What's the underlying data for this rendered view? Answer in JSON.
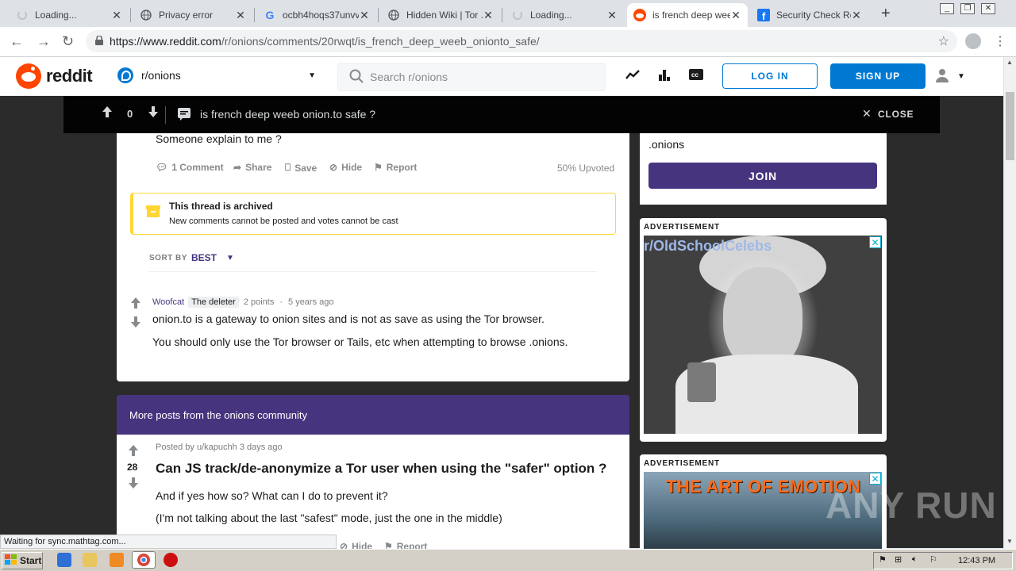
{
  "browser": {
    "tabs": [
      {
        "title": "Loading...",
        "favicon": "spinner"
      },
      {
        "title": "Privacy error",
        "favicon": "globe-icon"
      },
      {
        "title": "ocbh4hoqs37unvv",
        "favicon": "google-icon"
      },
      {
        "title": "Hidden Wiki | Tor .",
        "favicon": "globe-icon"
      },
      {
        "title": "Loading...",
        "favicon": "spinner"
      },
      {
        "title": "is french deep wee",
        "favicon": "reddit-icon",
        "active": true
      },
      {
        "title": "Security Check Rec",
        "favicon": "facebook-icon"
      }
    ],
    "new_tab": "+",
    "url_host": "https://www.reddit.com",
    "url_path": "/r/onions/comments/20rwqt/is_french_deep_weeb_onionto_safe/",
    "status_text": "Waiting for sync.mathtag.com..."
  },
  "header": {
    "logo_text": "reddit",
    "community": "r/onions",
    "search_placeholder": "Search r/onions",
    "login": "LOG IN",
    "signup": "SIGN UP"
  },
  "postbar": {
    "score": "0",
    "title": "is french deep weeb onion.to safe ?",
    "close": "CLOSE"
  },
  "post": {
    "body_tail": "Someone explain to me ?",
    "actions": {
      "comments": "1 Comment",
      "share": "Share",
      "save": "Save",
      "hide": "Hide",
      "report": "Report"
    },
    "upvoted": "50% Upvoted"
  },
  "archived": {
    "title": "This thread is archived",
    "text": "New comments cannot be posted and votes cannot be cast"
  },
  "sort": {
    "label": "SORT BY",
    "value": "BEST"
  },
  "comment": {
    "author": "Woofcat",
    "flair": "The deleter",
    "points": "2 points",
    "dot": "·",
    "time": "5 years ago",
    "line1": "onion.to is a gateway to onion sites and is not as save as using the Tor browser.",
    "line2": "You should only use the Tor browser or Tails, etc when attempting to browse .onions."
  },
  "sidebar": {
    "tail": ".onions",
    "join": "JOIN",
    "ad_label": "ADVERTISEMENT",
    "ad1_title": "r/OldSchoolCelebs",
    "ad2_title": "THE ART OF EMOTION"
  },
  "more_posts": {
    "header": "More posts from the onions community",
    "posted_by": "Posted by u/kapuchh",
    "time": "3 days ago",
    "score": "28",
    "title": "Can JS track/de-anonymize a Tor user when using the \"safer\" option ?",
    "body1": "And if yes how so? What can I do to prevent it?",
    "body2": "(I'm not talking about the last \"safest\" mode, just the one in the middle)",
    "hide": "Hide",
    "report": "Report"
  },
  "watermark": "ANY RUN",
  "taskbar": {
    "start": "Start",
    "clock": "12:43 PM"
  },
  "colors": {
    "reddit_orange": "#ff4500",
    "reddit_blue": "#0079d3",
    "community_purple": "#46347f",
    "archived_yellow": "#ffd635"
  }
}
